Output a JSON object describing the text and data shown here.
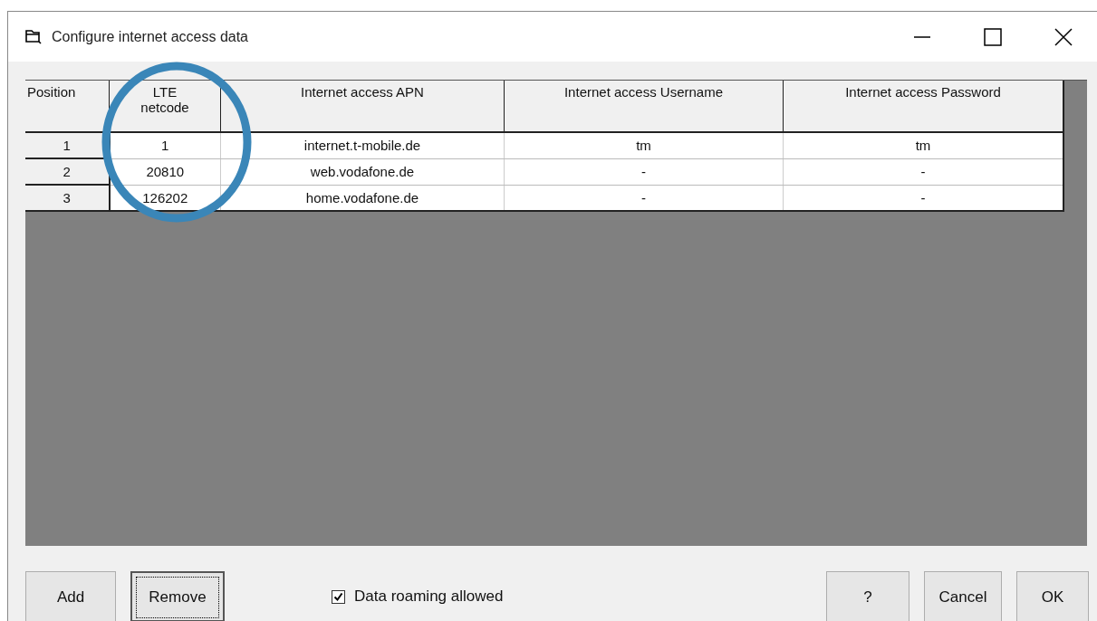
{
  "window": {
    "title": "Configure internet access data"
  },
  "table": {
    "columns": [
      "Position",
      "LTE netcode",
      "Internet access APN",
      "Internet access Username",
      "Internet access Password"
    ],
    "rows": [
      [
        "1",
        "1",
        "internet.t-mobile.de",
        "tm",
        "tm"
      ],
      [
        "2",
        "20810",
        "web.vodafone.de",
        "-",
        "-"
      ],
      [
        "3",
        "126202",
        "home.vodafone.de",
        "-",
        "-"
      ]
    ]
  },
  "buttons_left": [
    {
      "label": "Add",
      "focused": false
    },
    {
      "label": "Remove",
      "focused": true
    }
  ],
  "roaming": {
    "label": "Data roaming allowed",
    "checked": true
  },
  "buttons_right": [
    {
      "label": "?",
      "focused": false
    },
    {
      "label": "Cancel",
      "focused": false
    },
    {
      "label": "OK",
      "focused": false
    }
  ]
}
